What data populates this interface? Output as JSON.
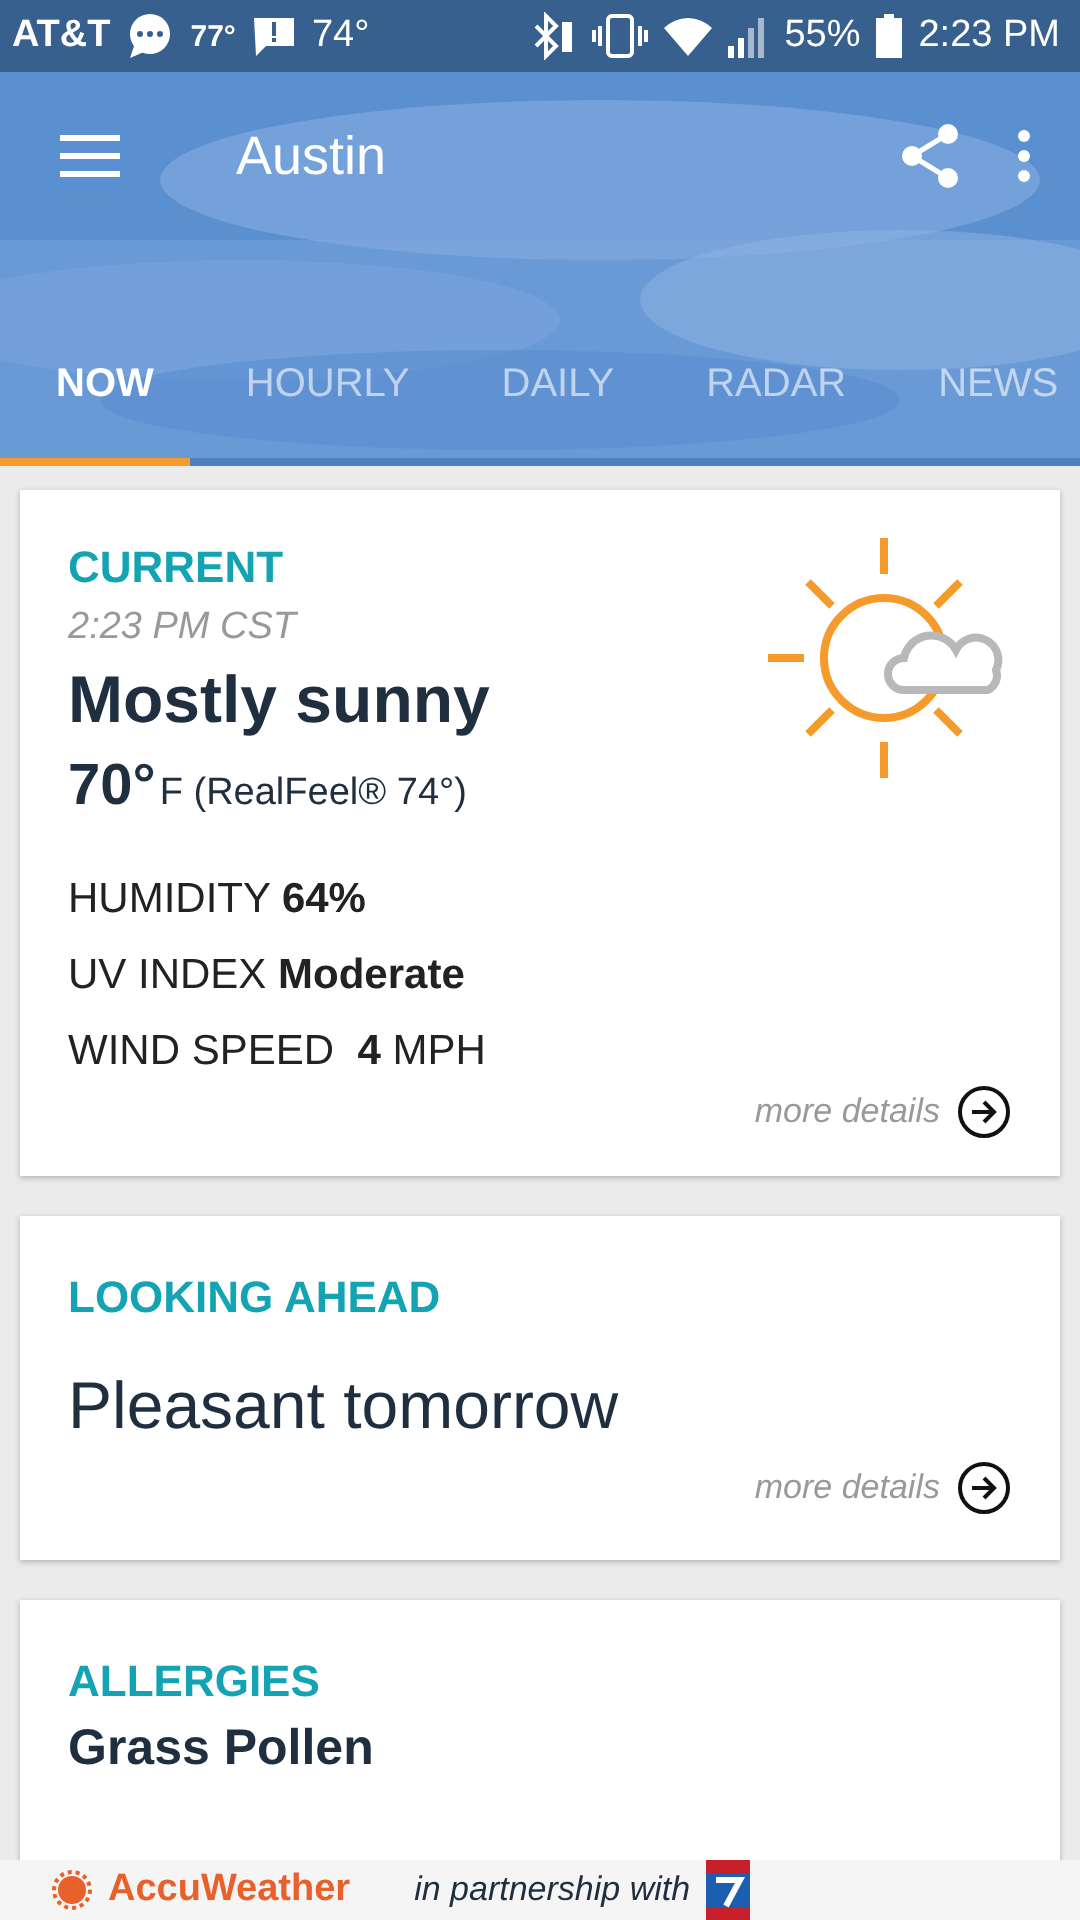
{
  "status_bar": {
    "carrier": "AT&T",
    "temp_1": "77°",
    "temp_2": "74°",
    "battery": "55%",
    "time": "2:23 PM"
  },
  "toolbar": {
    "title": "Austin"
  },
  "tabs": [
    {
      "label": "NOW",
      "selected": true
    },
    {
      "label": "HOURLY",
      "selected": false
    },
    {
      "label": "DAILY",
      "selected": false
    },
    {
      "label": "RADAR",
      "selected": false
    },
    {
      "label": "NEWS",
      "selected": false
    }
  ],
  "current": {
    "heading": "CURRENT",
    "time": "2:23 PM CST",
    "condition": "Mostly sunny",
    "temperature": "70°",
    "realfeel": "F (RealFeel® 74°)",
    "details": [
      "HUMIDITY **64%**",
      "UV INDEX **Moderate**",
      "WIND SPEED  **4** MPH"
    ],
    "more": "more details"
  },
  "looking_ahead": {
    "heading": "LOOKING AHEAD",
    "summary": "Pleasant tomorrow",
    "more": "more details"
  },
  "allergies": {
    "heading": "ALLERGIES",
    "summary": "Grass Pollen"
  },
  "footer": {
    "brand": "AccuWeather",
    "partner_text": "in partnership with"
  }
}
